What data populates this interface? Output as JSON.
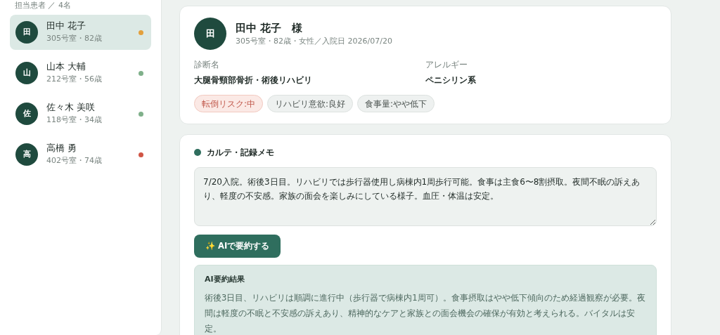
{
  "sidebar": {
    "heading": "担当患者 ／ 4名",
    "patients": [
      {
        "initial": "田",
        "name": "田中 花子",
        "detail": "305号室・82歳",
        "color": "#e3a03c",
        "selected": true
      },
      {
        "initial": "山",
        "name": "山本 大輔",
        "detail": "212号室・56歳",
        "color": "#7fb08a",
        "selected": false
      },
      {
        "initial": "佐",
        "name": "佐々木 美咲",
        "detail": "118号室・34歳",
        "color": "#7fb08a",
        "selected": false
      },
      {
        "initial": "高",
        "name": "高橋 勇",
        "detail": "402号室・74歳",
        "color": "#d05545",
        "selected": false
      }
    ]
  },
  "profile": {
    "initial": "田",
    "name": "田中 花子　様",
    "detail": "305号室・82歳・女性／入院日 2026/07/20",
    "fields": [
      {
        "label": "診断名",
        "value": "大腿骨頸部骨折・術後リハビリ"
      },
      {
        "label": "アレルギー",
        "value": "ペニシリン系"
      }
    ],
    "tags": [
      {
        "text": "転倒リスク:中",
        "kind": "warning"
      },
      {
        "text": "リハビリ意欲:良好",
        "kind": "neutral"
      },
      {
        "text": "食事量:やや低下",
        "kind": "neutral"
      }
    ]
  },
  "notes": {
    "title": "カルテ・記録メモ",
    "value": "7/20入院。術後3日目。リハビリでは歩行器使用し病棟内1周歩行可能。食事は主食6〜8割摂取。夜間不眠の訴えあり、軽度の不安感。家族の面会を楽しみにしている様子。血圧・体温は安定。",
    "button": "✨ AIで要約する",
    "summary_title": "AI要約結果",
    "summary": "術後3日目、リハビリは順調に進行中（歩行器で病棟内1周可）。食事摂取はやや低下傾向のため経過観察が必要。夜間は軽度の不眠と不安感の訴えあり、精神的なケアと家族との面会機会の確保が有効と考えられる。バイタルは安定。"
  }
}
